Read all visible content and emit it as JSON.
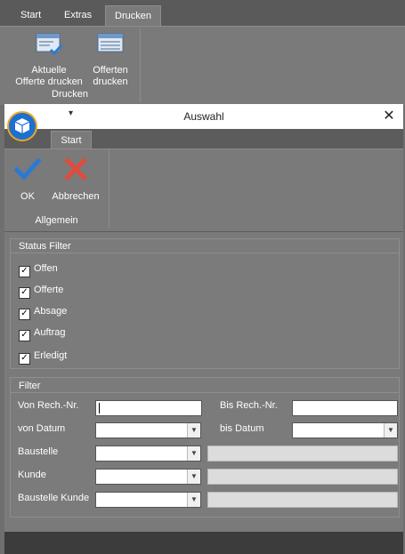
{
  "background_app": {
    "tabs": [
      "Start",
      "Extras",
      "Drucken"
    ],
    "active_tab": "Drucken",
    "buttons": [
      {
        "label_line1": "Aktuelle",
        "label_line2": "Offerte drucken"
      },
      {
        "label_line1": "Offerten",
        "label_line2": "drucken"
      }
    ],
    "group_label": "Drucken"
  },
  "dialog": {
    "title": "Auswahl",
    "quick_access_glyph": "▾",
    "close_glyph": "✕",
    "tab": "Start",
    "ok_label": "OK",
    "cancel_label": "Abbrechen",
    "group_label": "Allgemein",
    "colors": {
      "ok_check": "#2a7ad5",
      "cancel_x": "#e04b3c"
    }
  },
  "status_filter": {
    "title": "Status Filter",
    "items": [
      {
        "label": "Offen",
        "checked": true
      },
      {
        "label": "Offerte",
        "checked": true
      },
      {
        "label": "Absage",
        "checked": true
      },
      {
        "label": "Auftrag",
        "checked": true
      },
      {
        "label": "Erledigt",
        "checked": true
      }
    ]
  },
  "filter": {
    "title": "Filter",
    "von_rech_label": "Von Rech.-Nr.",
    "bis_rech_label": "Bis Rech.-Nr.",
    "von_datum_label": "von Datum",
    "bis_datum_label": "bis Datum",
    "baustelle_label": "Baustelle",
    "kunde_label": "Kunde",
    "baustelle_kunde_label": "Baustelle Kunde",
    "von_rech_value": "",
    "bis_rech_value": "",
    "von_datum_value": "",
    "bis_datum_value": "",
    "baustelle_value": "",
    "kunde_value": "",
    "baustelle_kunde_value": ""
  }
}
